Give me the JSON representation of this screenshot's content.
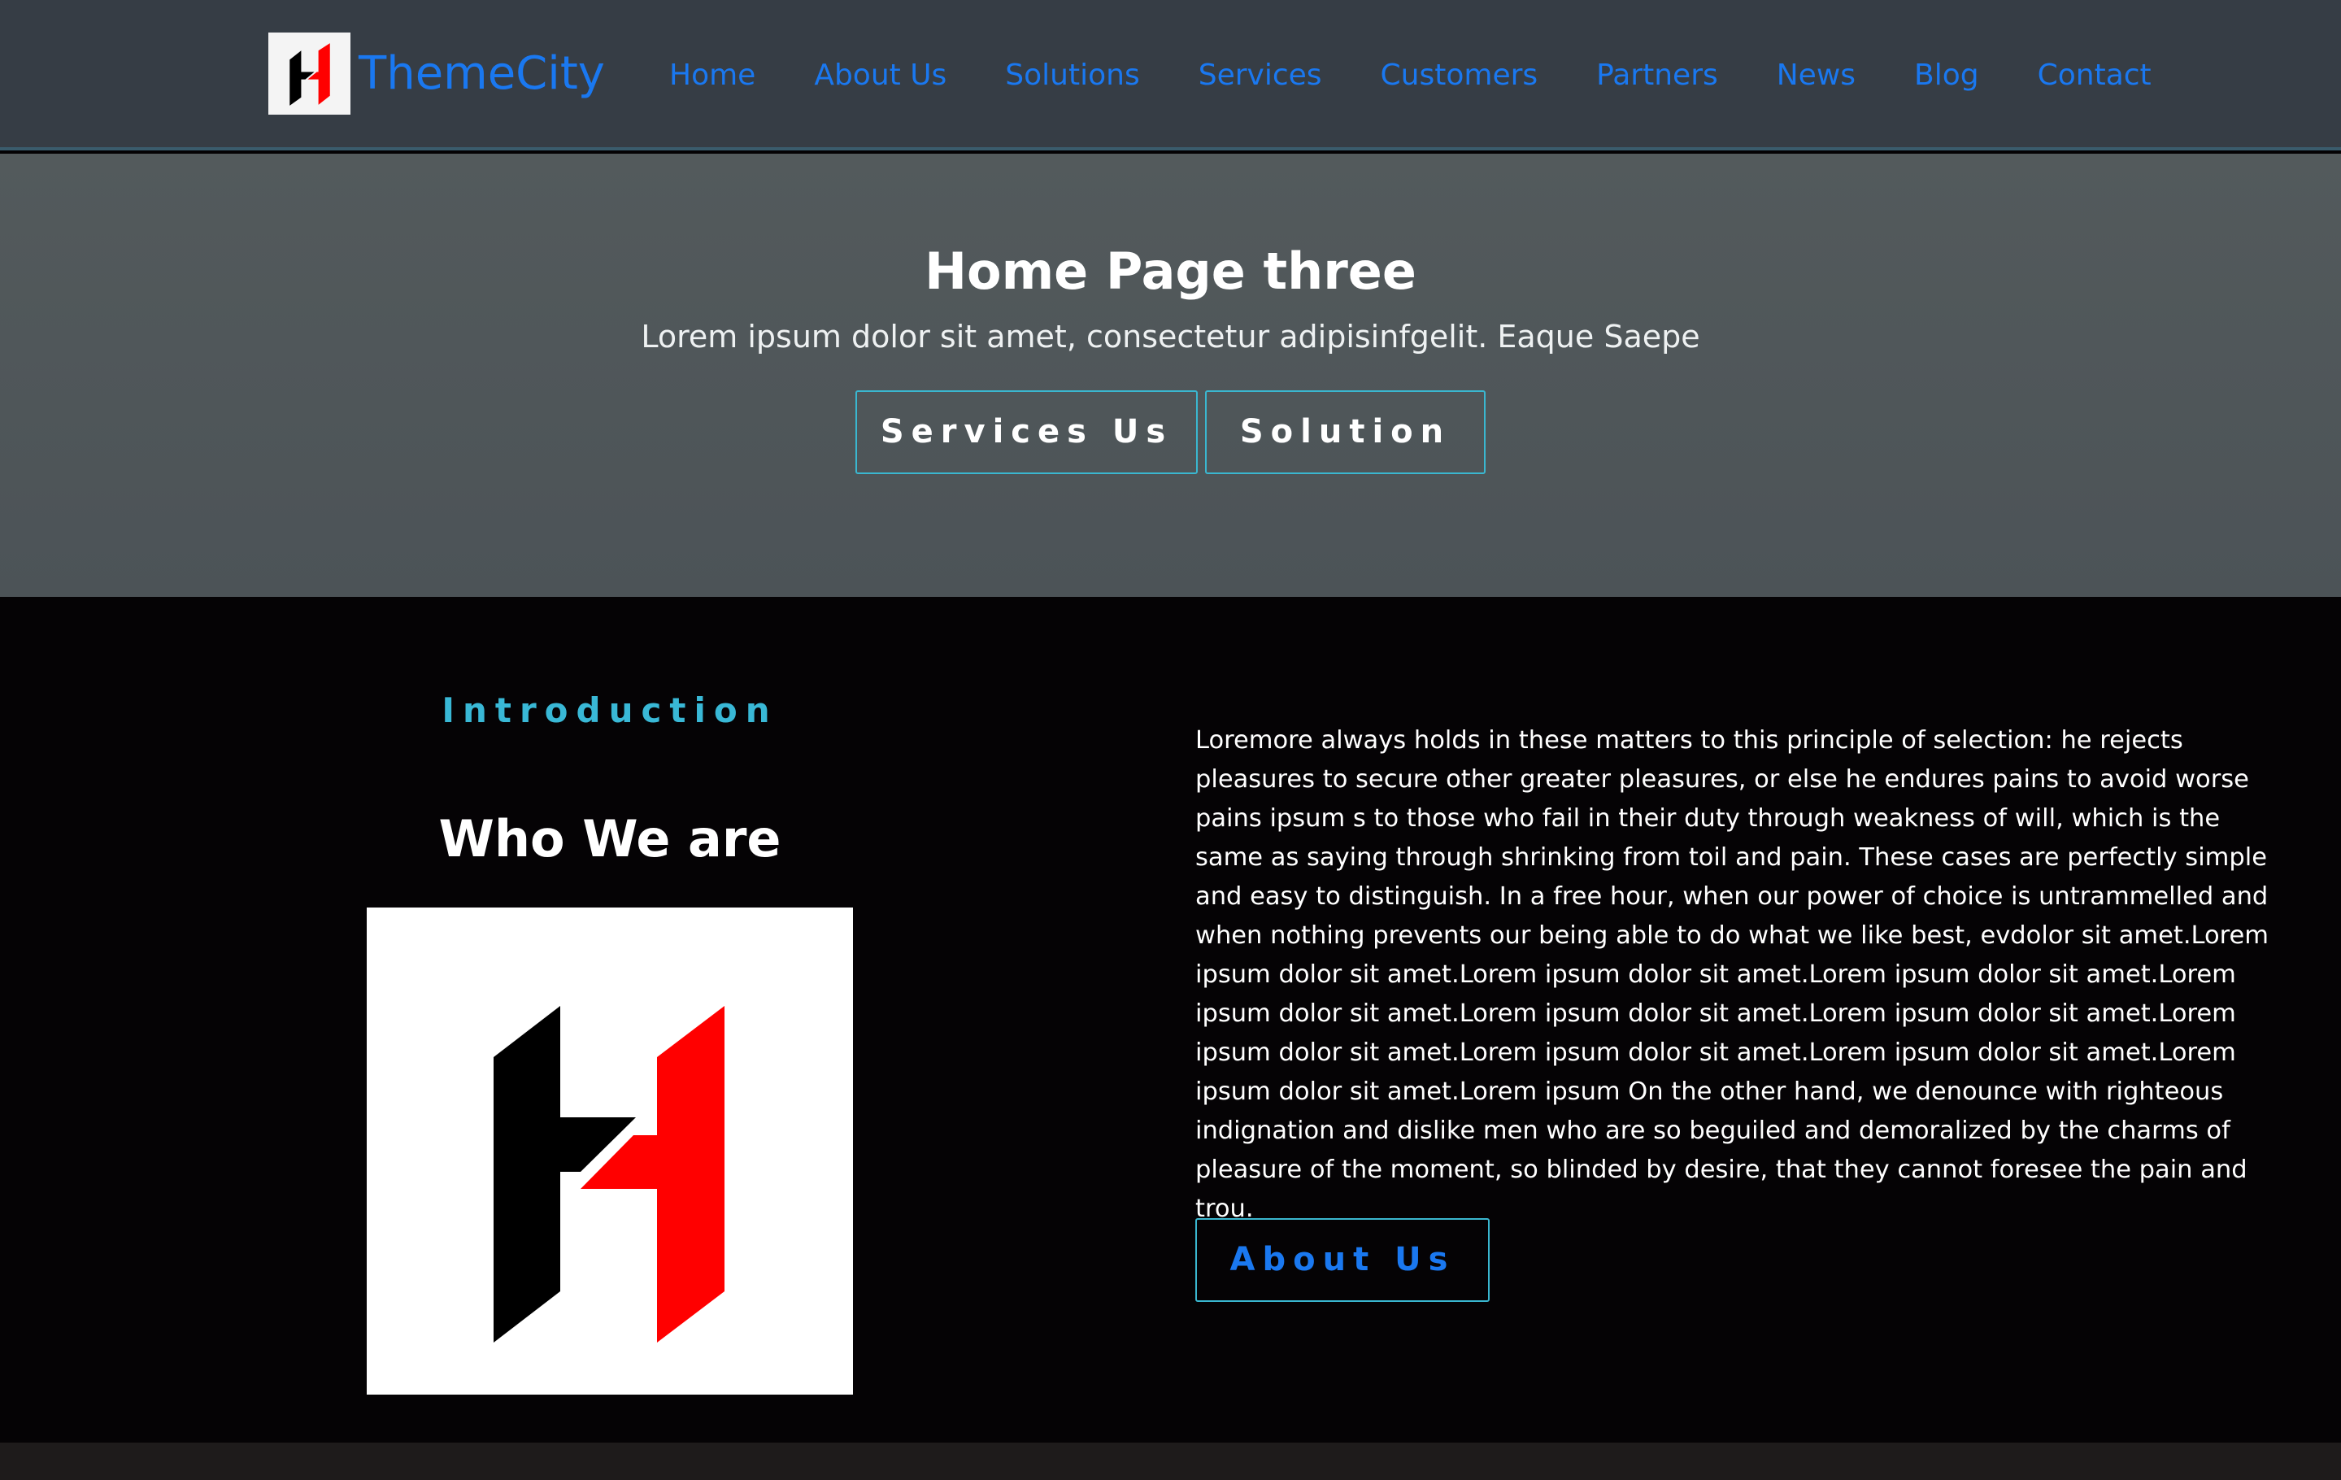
{
  "brand": {
    "name": "ThemeCity",
    "logo_icon": "h-letter-logo-icon"
  },
  "nav": {
    "items": [
      {
        "label": "Home"
      },
      {
        "label": "About Us"
      },
      {
        "label": "Solutions"
      },
      {
        "label": "Services"
      },
      {
        "label": "Customers"
      },
      {
        "label": "Partners"
      },
      {
        "label": "News"
      },
      {
        "label": "Blog"
      },
      {
        "label": "Contact"
      }
    ]
  },
  "hero": {
    "title": "Home Page three",
    "subtitle": "Lorem ipsum dolor sit amet, consectetur adipisinfgelit. Eaque Saepe",
    "buttons": {
      "services": "Services Us",
      "solution": "Solution"
    }
  },
  "about": {
    "eyebrow": "Introduction",
    "title": "Who We are",
    "logo_icon": "h-letter-logo-icon",
    "body": "Loremore always holds in these matters to this principle of selection: he rejects pleasures to secure other greater pleasures, or else he endures pains to avoid worse pains ipsum s to those who fail in their duty through weakness of will, which is the same as saying through shrinking from toil and pain. These cases are perfectly simple and easy to distinguish. In a free hour, when our power of choice is untrammelled and when nothing prevents our being able to do what we like best, evdolor sit amet.Lorem ipsum dolor sit amet.Lorem ipsum dolor sit amet.Lorem ipsum dolor sit amet.Lorem ipsum dolor sit amet.Lorem ipsum dolor sit amet.Lorem ipsum dolor sit amet.Lorem ipsum dolor sit amet.Lorem ipsum dolor sit amet.Lorem ipsum dolor sit amet.Lorem ipsum dolor sit amet.Lorem ipsum On the other hand, we denounce with righteous indignation and dislike men who are so beguiled and demoralized by the charms of pleasure of the moment, so blinded by desire, that they cannot foresee the pain and trou.",
    "button": "About Us"
  },
  "colors": {
    "accent_blue": "#1a78f0",
    "accent_cyan": "#39b8d6",
    "logo_red": "#ff0000",
    "logo_black": "#000000",
    "navbar_bg": "#363d45",
    "hero_bg": "#4f5659",
    "section_bg": "#050305"
  }
}
